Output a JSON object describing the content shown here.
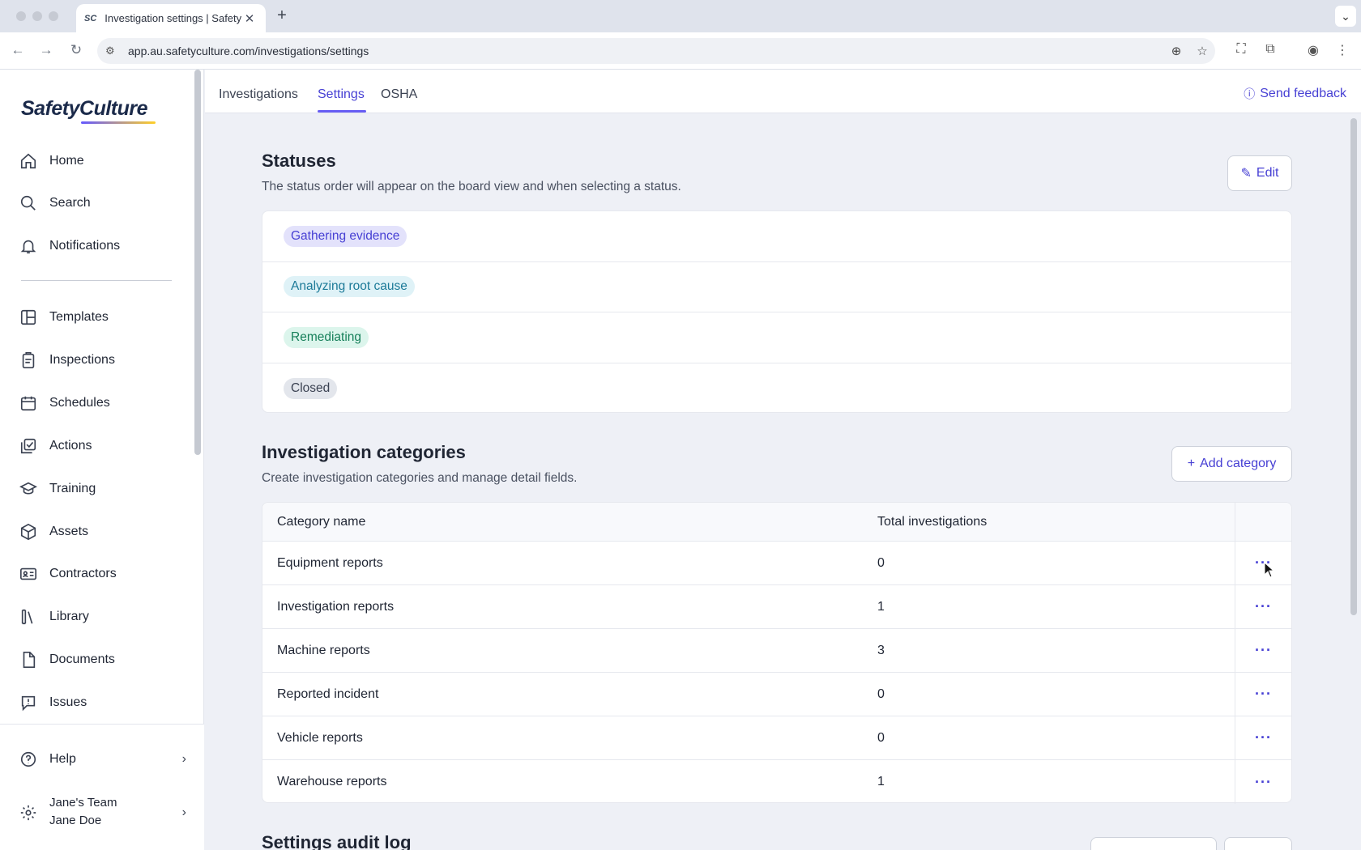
{
  "browser": {
    "tab_title": "Investigation settings | SafetyCulture",
    "tab_favicon": "SC",
    "url": "app.au.safetyculture.com/investigations/settings"
  },
  "sidebar": {
    "logo": "SafetyCulture",
    "items": [
      {
        "label": "Home",
        "icon": "home-icon"
      },
      {
        "label": "Search",
        "icon": "search-icon"
      },
      {
        "label": "Notifications",
        "icon": "bell-icon"
      },
      {
        "label": "Templates",
        "icon": "templates-icon"
      },
      {
        "label": "Inspections",
        "icon": "clipboard-icon"
      },
      {
        "label": "Schedules",
        "icon": "calendar-icon"
      },
      {
        "label": "Actions",
        "icon": "actions-icon"
      },
      {
        "label": "Training",
        "icon": "graduation-cap-icon"
      },
      {
        "label": "Assets",
        "icon": "cube-icon"
      },
      {
        "label": "Contractors",
        "icon": "id-card-icon"
      },
      {
        "label": "Library",
        "icon": "books-icon"
      },
      {
        "label": "Documents",
        "icon": "document-icon"
      },
      {
        "label": "Issues",
        "icon": "issue-icon"
      }
    ],
    "help": "Help",
    "team_name": "Jane's Team",
    "user_name": "Jane Doe"
  },
  "topnav": {
    "tabs": [
      "Investigations",
      "Settings",
      "OSHA"
    ],
    "active_tab": "Settings",
    "feedback": "Send feedback"
  },
  "statuses": {
    "title": "Statuses",
    "subtitle": "The status order will appear on the board view and when selecting a status.",
    "edit_label": "Edit",
    "items": [
      {
        "label": "Gathering evidence",
        "bg": "#e3e2fb",
        "fg": "#4740d4"
      },
      {
        "label": "Analyzing root cause",
        "bg": "#dff2f7",
        "fg": "#1c7a98"
      },
      {
        "label": "Remediating",
        "bg": "#dcf5ec",
        "fg": "#17805a"
      },
      {
        "label": "Closed",
        "bg": "#e3e6ec",
        "fg": "#3b4252"
      }
    ]
  },
  "categories": {
    "title": "Investigation categories",
    "subtitle": "Create investigation categories and manage detail fields.",
    "add_label": "Add category",
    "columns": [
      "Category name",
      "Total investigations"
    ],
    "rows": [
      {
        "name": "Equipment reports",
        "total": "0"
      },
      {
        "name": "Investigation reports",
        "total": "1"
      },
      {
        "name": "Machine reports",
        "total": "3"
      },
      {
        "name": "Reported incident",
        "total": "0"
      },
      {
        "name": "Vehicle reports",
        "total": "0"
      },
      {
        "name": "Warehouse reports",
        "total": "1"
      }
    ],
    "more_label": "···"
  },
  "audit": {
    "title": "Settings audit log"
  },
  "colors": {
    "accent": "#4740d4",
    "accent_light": "#675df4"
  }
}
